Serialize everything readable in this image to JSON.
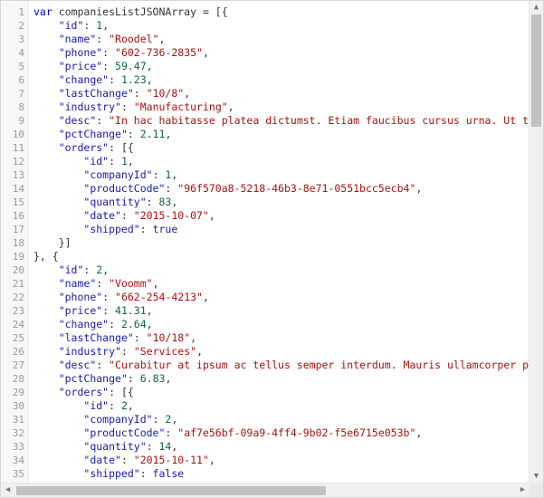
{
  "editor": {
    "lines": [
      [
        [
          "kw",
          "var "
        ],
        [
          "p",
          "companiesListJSONArray = [{"
        ]
      ],
      [
        [
          "p",
          "    "
        ],
        [
          "key",
          "\"id\""
        ],
        [
          "p",
          ": "
        ],
        [
          "num",
          "1"
        ],
        [
          "p",
          ","
        ]
      ],
      [
        [
          "p",
          "    "
        ],
        [
          "key",
          "\"name\""
        ],
        [
          "p",
          ": "
        ],
        [
          "str",
          "\"Roodel\""
        ],
        [
          "p",
          ","
        ]
      ],
      [
        [
          "p",
          "    "
        ],
        [
          "key",
          "\"phone\""
        ],
        [
          "p",
          ": "
        ],
        [
          "str",
          "\"602-736-2835\""
        ],
        [
          "p",
          ","
        ]
      ],
      [
        [
          "p",
          "    "
        ],
        [
          "key",
          "\"price\""
        ],
        [
          "p",
          ": "
        ],
        [
          "num",
          "59.47"
        ],
        [
          "p",
          ","
        ]
      ],
      [
        [
          "p",
          "    "
        ],
        [
          "key",
          "\"change\""
        ],
        [
          "p",
          ": "
        ],
        [
          "num",
          "1.23"
        ],
        [
          "p",
          ","
        ]
      ],
      [
        [
          "p",
          "    "
        ],
        [
          "key",
          "\"lastChange\""
        ],
        [
          "p",
          ": "
        ],
        [
          "str",
          "\"10/8\""
        ],
        [
          "p",
          ","
        ]
      ],
      [
        [
          "p",
          "    "
        ],
        [
          "key",
          "\"industry\""
        ],
        [
          "p",
          ": "
        ],
        [
          "str",
          "\"Manufacturing\""
        ],
        [
          "p",
          ","
        ]
      ],
      [
        [
          "p",
          "    "
        ],
        [
          "key",
          "\"desc\""
        ],
        [
          "p",
          ": "
        ],
        [
          "str",
          "\"In hac habitasse platea dictumst. Etiam faucibus cursus urna. Ut tellus"
        ]
      ],
      [
        [
          "p",
          "    "
        ],
        [
          "key",
          "\"pctChange\""
        ],
        [
          "p",
          ": "
        ],
        [
          "num",
          "2.11"
        ],
        [
          "p",
          ","
        ]
      ],
      [
        [
          "p",
          "    "
        ],
        [
          "key",
          "\"orders\""
        ],
        [
          "p",
          ": [{"
        ]
      ],
      [
        [
          "p",
          "        "
        ],
        [
          "key",
          "\"id\""
        ],
        [
          "p",
          ": "
        ],
        [
          "num",
          "1"
        ],
        [
          "p",
          ","
        ]
      ],
      [
        [
          "p",
          "        "
        ],
        [
          "key",
          "\"companyId\""
        ],
        [
          "p",
          ": "
        ],
        [
          "num",
          "1"
        ],
        [
          "p",
          ","
        ]
      ],
      [
        [
          "p",
          "        "
        ],
        [
          "key",
          "\"productCode\""
        ],
        [
          "p",
          ": "
        ],
        [
          "str",
          "\"96f570a8-5218-46b3-8e71-0551bcc5ecb4\""
        ],
        [
          "p",
          ","
        ]
      ],
      [
        [
          "p",
          "        "
        ],
        [
          "key",
          "\"quantity\""
        ],
        [
          "p",
          ": "
        ],
        [
          "num",
          "83"
        ],
        [
          "p",
          ","
        ]
      ],
      [
        [
          "p",
          "        "
        ],
        [
          "key",
          "\"date\""
        ],
        [
          "p",
          ": "
        ],
        [
          "str",
          "\"2015-10-07\""
        ],
        [
          "p",
          ","
        ]
      ],
      [
        [
          "p",
          "        "
        ],
        [
          "key",
          "\"shipped\""
        ],
        [
          "p",
          ": "
        ],
        [
          "bool",
          "true"
        ]
      ],
      [
        [
          "p",
          "    }]"
        ]
      ],
      [
        [
          "p",
          "}, {"
        ]
      ],
      [
        [
          "p",
          "    "
        ],
        [
          "key",
          "\"id\""
        ],
        [
          "p",
          ": "
        ],
        [
          "num",
          "2"
        ],
        [
          "p",
          ","
        ]
      ],
      [
        [
          "p",
          "    "
        ],
        [
          "key",
          "\"name\""
        ],
        [
          "p",
          ": "
        ],
        [
          "str",
          "\"Voomm\""
        ],
        [
          "p",
          ","
        ]
      ],
      [
        [
          "p",
          "    "
        ],
        [
          "key",
          "\"phone\""
        ],
        [
          "p",
          ": "
        ],
        [
          "str",
          "\"662-254-4213\""
        ],
        [
          "p",
          ","
        ]
      ],
      [
        [
          "p",
          "    "
        ],
        [
          "key",
          "\"price\""
        ],
        [
          "p",
          ": "
        ],
        [
          "num",
          "41.31"
        ],
        [
          "p",
          ","
        ]
      ],
      [
        [
          "p",
          "    "
        ],
        [
          "key",
          "\"change\""
        ],
        [
          "p",
          ": "
        ],
        [
          "num",
          "2.64"
        ],
        [
          "p",
          ","
        ]
      ],
      [
        [
          "p",
          "    "
        ],
        [
          "key",
          "\"lastChange\""
        ],
        [
          "p",
          ": "
        ],
        [
          "str",
          "\"10/18\""
        ],
        [
          "p",
          ","
        ]
      ],
      [
        [
          "p",
          "    "
        ],
        [
          "key",
          "\"industry\""
        ],
        [
          "p",
          ": "
        ],
        [
          "str",
          "\"Services\""
        ],
        [
          "p",
          ","
        ]
      ],
      [
        [
          "p",
          "    "
        ],
        [
          "key",
          "\"desc\""
        ],
        [
          "p",
          ": "
        ],
        [
          "str",
          "\"Curabitur at ipsum ac tellus semper interdum. Mauris ullamcorper purus"
        ]
      ],
      [
        [
          "p",
          "    "
        ],
        [
          "key",
          "\"pctChange\""
        ],
        [
          "p",
          ": "
        ],
        [
          "num",
          "6.83"
        ],
        [
          "p",
          ","
        ]
      ],
      [
        [
          "p",
          "    "
        ],
        [
          "key",
          "\"orders\""
        ],
        [
          "p",
          ": [{"
        ]
      ],
      [
        [
          "p",
          "        "
        ],
        [
          "key",
          "\"id\""
        ],
        [
          "p",
          ": "
        ],
        [
          "num",
          "2"
        ],
        [
          "p",
          ","
        ]
      ],
      [
        [
          "p",
          "        "
        ],
        [
          "key",
          "\"companyId\""
        ],
        [
          "p",
          ": "
        ],
        [
          "num",
          "2"
        ],
        [
          "p",
          ","
        ]
      ],
      [
        [
          "p",
          "        "
        ],
        [
          "key",
          "\"productCode\""
        ],
        [
          "p",
          ": "
        ],
        [
          "str",
          "\"af7e56bf-09a9-4ff4-9b02-f5e6715e053b\""
        ],
        [
          "p",
          ","
        ]
      ],
      [
        [
          "p",
          "        "
        ],
        [
          "key",
          "\"quantity\""
        ],
        [
          "p",
          ": "
        ],
        [
          "num",
          "14"
        ],
        [
          "p",
          ","
        ]
      ],
      [
        [
          "p",
          "        "
        ],
        [
          "key",
          "\"date\""
        ],
        [
          "p",
          ": "
        ],
        [
          "str",
          "\"2015-10-11\""
        ],
        [
          "p",
          ","
        ]
      ],
      [
        [
          "p",
          "        "
        ],
        [
          "key",
          "\"shipped\""
        ],
        [
          "p",
          ": "
        ],
        [
          "bool",
          "false"
        ]
      ]
    ],
    "line_numbers": [
      "1",
      "2",
      "3",
      "4",
      "5",
      "6",
      "7",
      "8",
      "9",
      "10",
      "11",
      "12",
      "13",
      "14",
      "15",
      "16",
      "17",
      "18",
      "19",
      "20",
      "21",
      "22",
      "23",
      "24",
      "25",
      "26",
      "27",
      "28",
      "29",
      "30",
      "31",
      "32",
      "33",
      "34",
      "35"
    ]
  },
  "icons": {
    "scroll_up": "arrow-up-icon",
    "scroll_down": "arrow-down-icon",
    "scroll_left": "arrow-left-icon",
    "scroll_right": "arrow-right-icon"
  },
  "colors": {
    "key": "#1a1aa6",
    "string": "#aa1111",
    "number": "#116644",
    "keyword": "#0000cc"
  }
}
